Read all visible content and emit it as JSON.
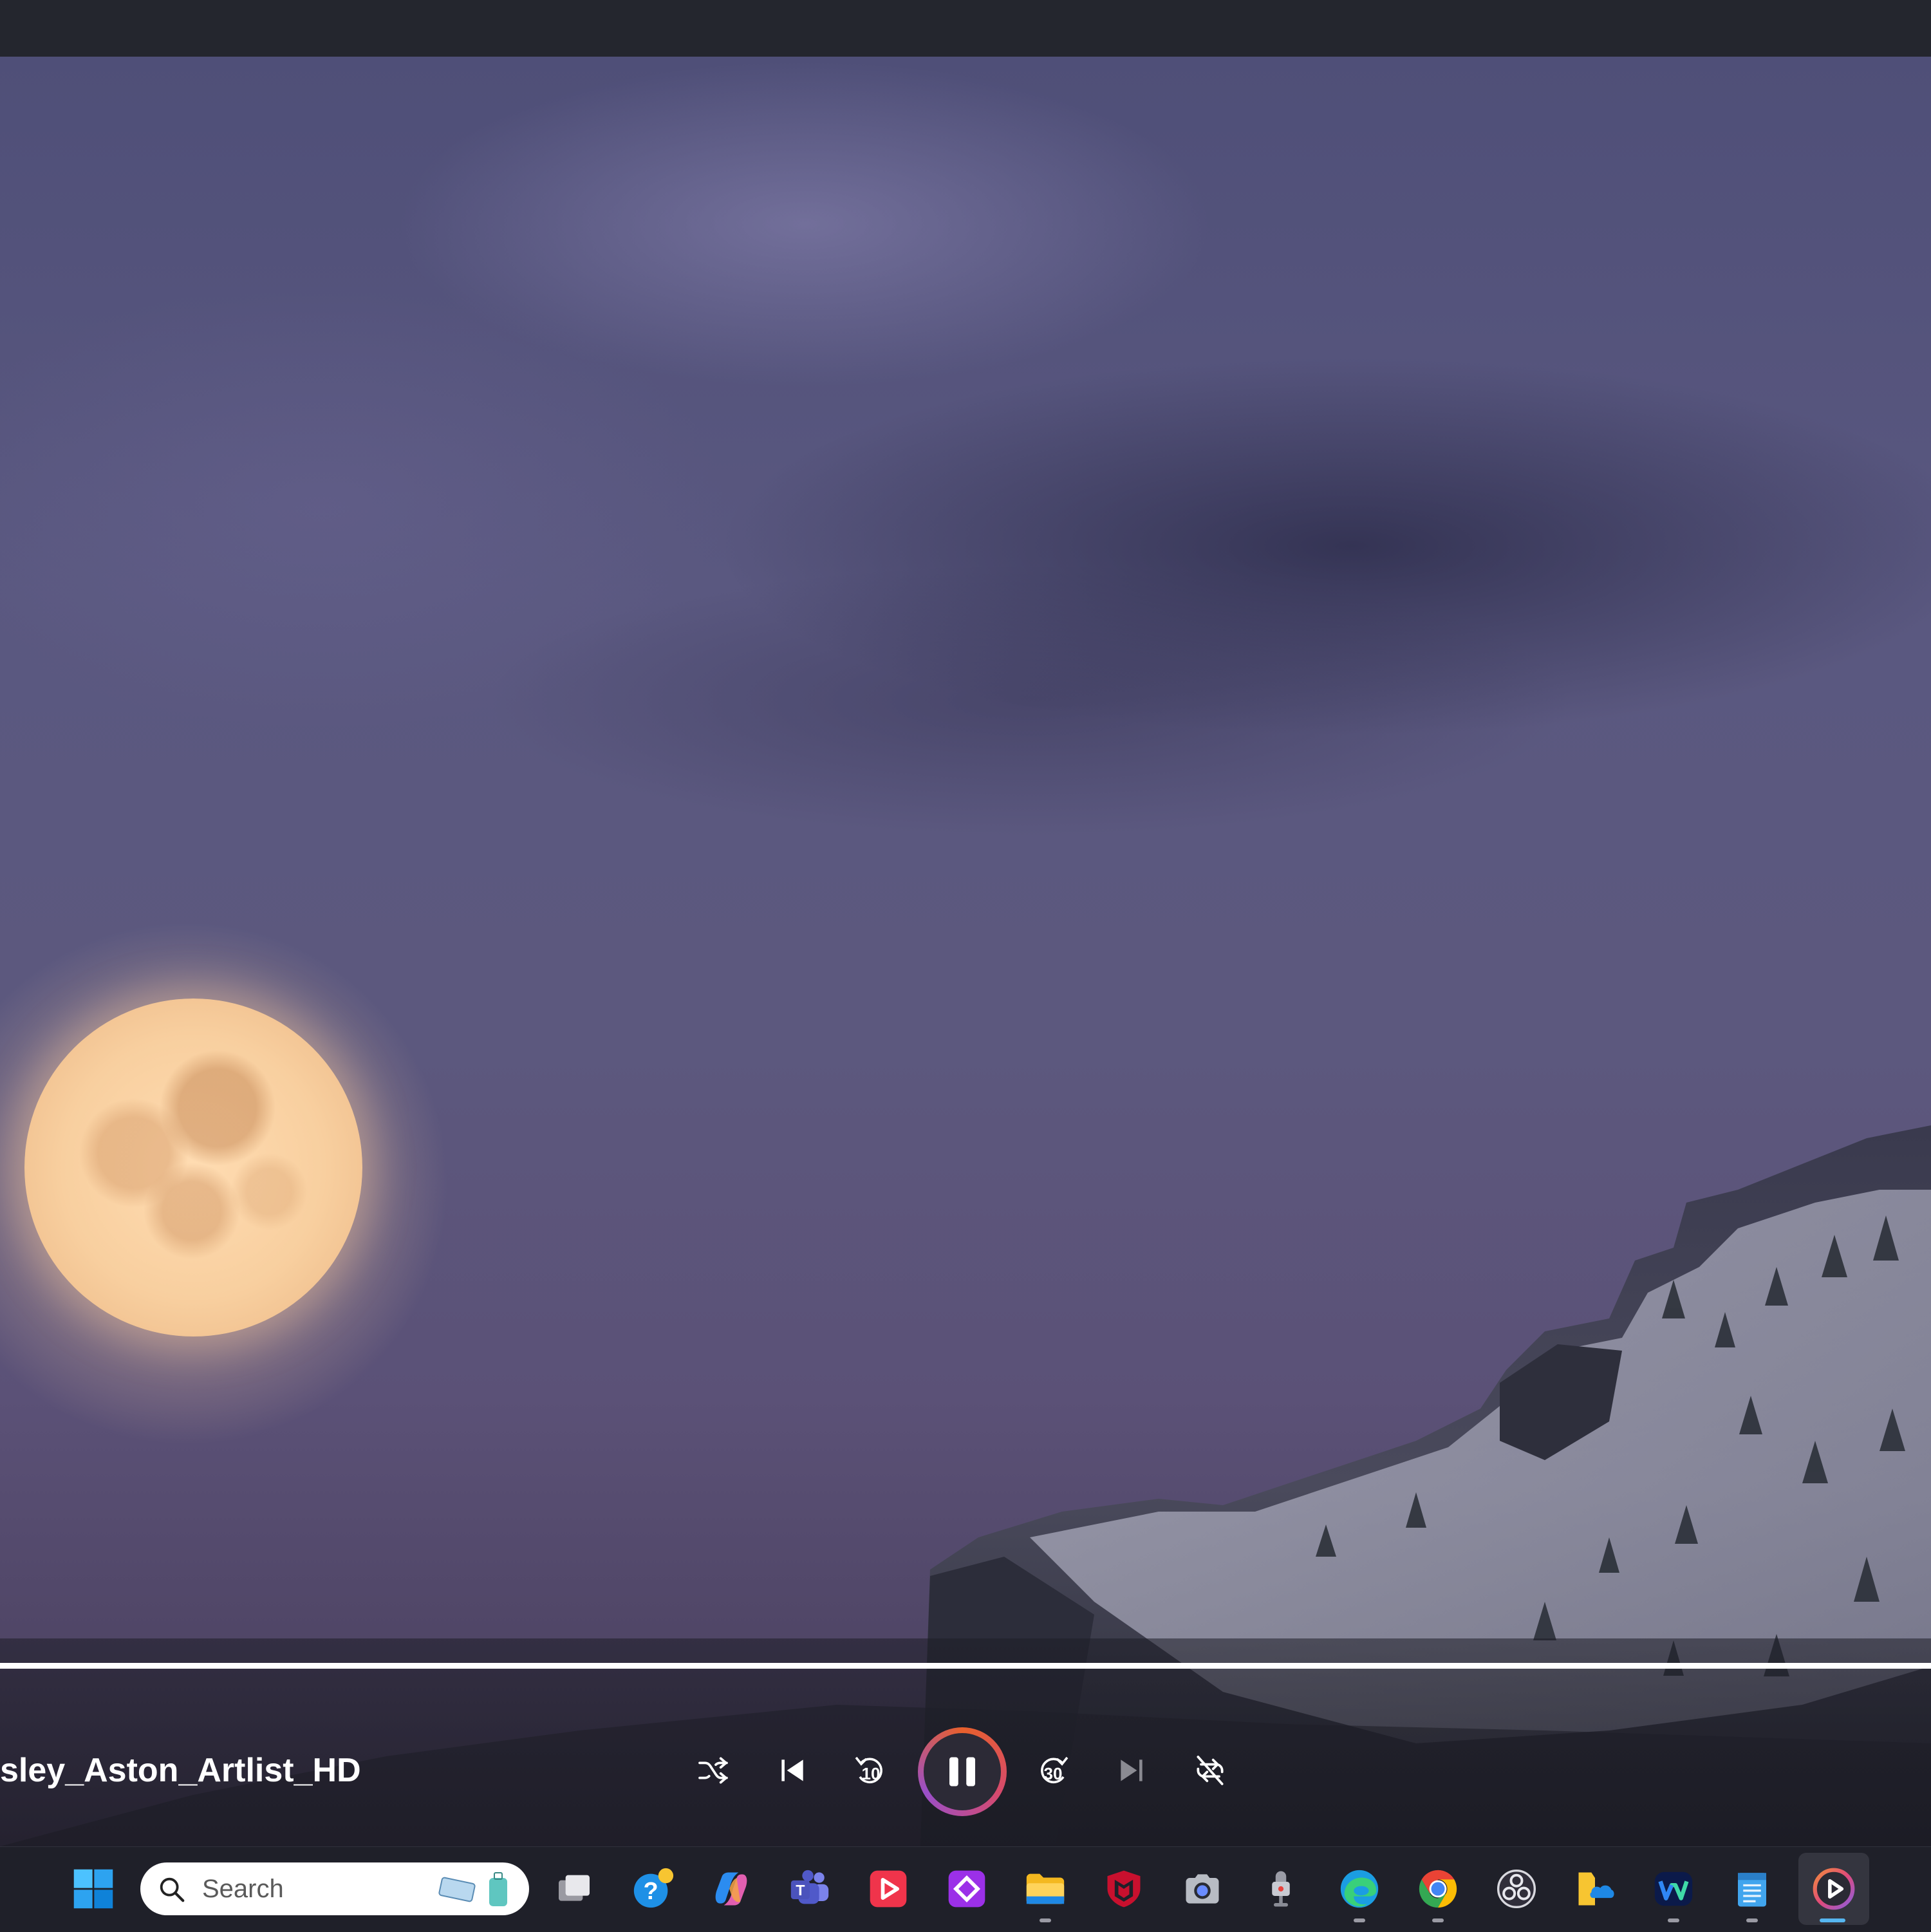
{
  "player": {
    "media_title": "sley_Aston_Artlist_HD",
    "progress_percent": 100
  },
  "controls": {
    "shuffle": "shuffle-icon",
    "previous": "previous-icon",
    "skip_back": "10",
    "pause": "pause-icon",
    "skip_forward": "30",
    "next": "next-icon",
    "repeat": "repeat-off-icon"
  },
  "taskbar": {
    "search_placeholder": "Search",
    "apps": [
      "windows-start",
      "task-view",
      "get-help",
      "copilot",
      "teams",
      "youtube-player",
      "purple-app",
      "file-explorer",
      "mcafee",
      "camera",
      "voice-recorder",
      "edge",
      "chrome",
      "obs-studio",
      "onedrive-files",
      "webex",
      "notepad",
      "media-player"
    ]
  },
  "colors": {
    "accent_orange": "#e8602c",
    "accent_pink": "#d64a6d",
    "accent_purple": "#9a4fc9",
    "active_indicator": "#56b6f0"
  }
}
